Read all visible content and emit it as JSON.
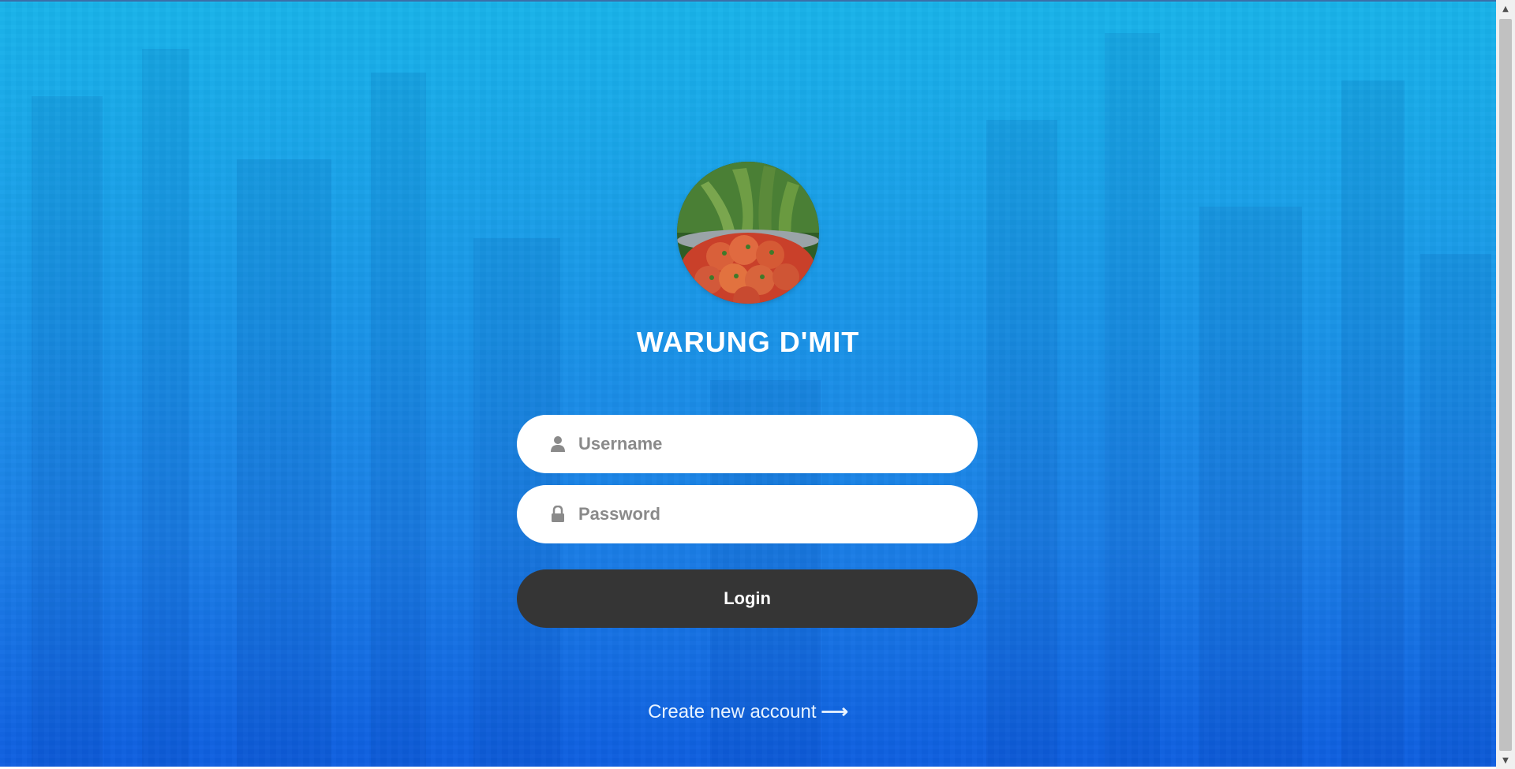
{
  "app": {
    "brand_title": "WARUNG D'MIT"
  },
  "login_form": {
    "username_placeholder": "Username",
    "password_placeholder": "Password",
    "login_label": "Login",
    "create_account_label": "Create new account",
    "create_account_arrow": "⟶"
  },
  "icons": {
    "username": "user-icon",
    "password": "lock-icon"
  },
  "colors": {
    "background_top": "#19b4ea",
    "background_bottom": "#0f5fe0",
    "login_button": "#353535",
    "field_background": "#ffffff",
    "placeholder": "#8a8a8a"
  }
}
